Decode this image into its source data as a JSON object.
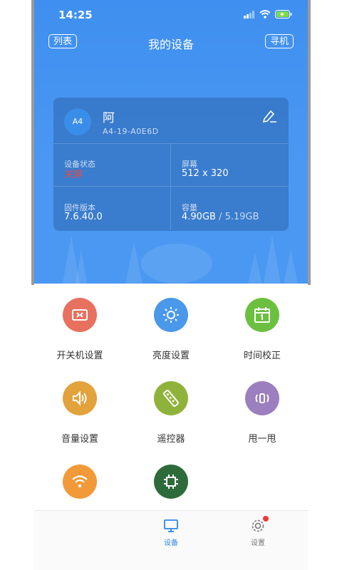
{
  "status_bar": {
    "time": "14:25"
  },
  "nav": {
    "left_button": "列表",
    "title": "我的设备",
    "right_button": "寻机"
  },
  "device": {
    "avatar_text": "A4",
    "name": "阿",
    "id": "A4-19-A0E6D",
    "status_label": "设备状态",
    "status_value": "关屏",
    "screen_label": "屏幕",
    "screen_value": "512 x 320",
    "firmware_label": "固件版本",
    "firmware_value": "7.6.40.0",
    "capacity_label": "容量",
    "capacity_used": "4.90GB",
    "capacity_sep": " / ",
    "capacity_total": "5.19GB"
  },
  "functions": [
    {
      "label": "开关机设置",
      "icon": "power-schedule-icon",
      "color": "#e8705e"
    },
    {
      "label": "亮度设置",
      "icon": "brightness-icon",
      "color": "#4a98ea"
    },
    {
      "label": "时间校正",
      "icon": "calendar-icon",
      "color": "#6cc040"
    },
    {
      "label": "音量设置",
      "icon": "volume-icon",
      "color": "#e2a23c"
    },
    {
      "label": "遥控器",
      "icon": "remote-icon",
      "color": "#8fb33a"
    },
    {
      "label": "甩一甩",
      "icon": "shake-icon",
      "color": "#9b7fbf"
    },
    {
      "label": "",
      "icon": "wifi-icon",
      "color": "#f29a3a"
    },
    {
      "label": "",
      "icon": "chip-icon",
      "color": "#2e6b3a"
    }
  ],
  "tabbar": {
    "device_label": "设备",
    "settings_label": "设置"
  },
  "colors": {
    "accent": "#2a86e8",
    "hero": "#4a98f2",
    "badge": "#e83b3b"
  }
}
